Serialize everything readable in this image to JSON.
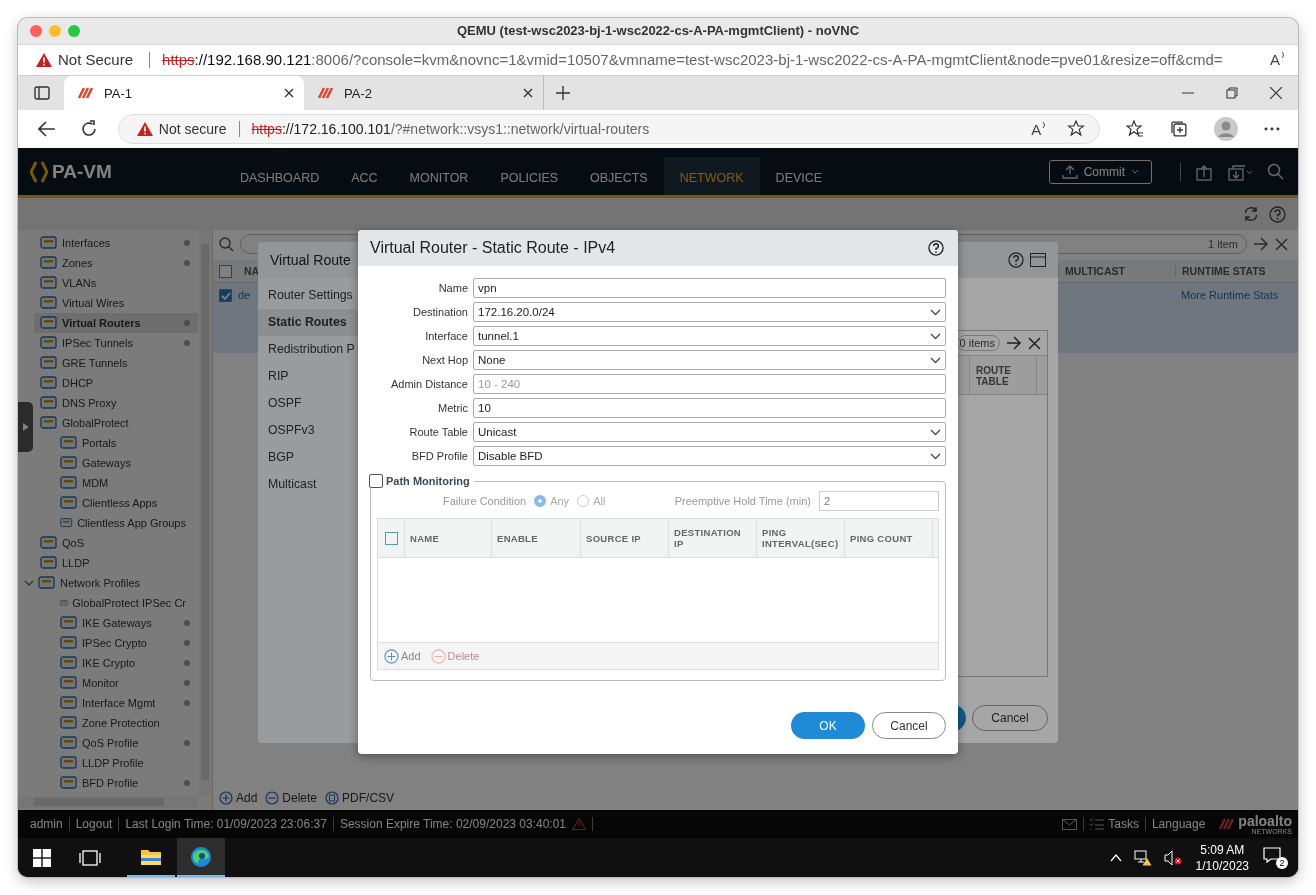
{
  "window": {
    "title": "QEMU (test-wsc2023-bj-1-wsc2022-cs-A-PA-mgmtClient) - noVNC"
  },
  "outer_address_bar": {
    "read_aloud": "A",
    "security": "Not Secure",
    "scheme": "https",
    "host": "://192.168.90.121",
    "rest": ":8006/?console=kvm&novnc=1&vmid=10507&vmname=test-wsc2023-bj-1-wsc2022-cs-A-PA-mgmtClient&node=pve01&resize=off&cmd="
  },
  "browser_tabs": [
    {
      "label": "PA-1",
      "selected": true
    },
    {
      "label": "PA-2",
      "selected": false
    }
  ],
  "address_bar": {
    "read_aloud": "A",
    "security": "Not secure",
    "scheme": "https",
    "host": "://172.16.100.101",
    "rest": "/?#network::vsys1::network/virtual-routers"
  },
  "app": {
    "logo": "PA-VM",
    "nav": [
      {
        "label": "DASHBOARD",
        "selected": false
      },
      {
        "label": "ACC",
        "selected": false
      },
      {
        "label": "MONITOR",
        "selected": false
      },
      {
        "label": "POLICIES",
        "selected": false
      },
      {
        "label": "OBJECTS",
        "selected": false
      },
      {
        "label": "NETWORK",
        "selected": true
      },
      {
        "label": "DEVICE",
        "selected": false
      }
    ],
    "commit": "Commit"
  },
  "sidebar": {
    "items": [
      {
        "label": "Interfaces",
        "dot": true,
        "selected": false
      },
      {
        "label": "Zones",
        "dot": true,
        "selected": false
      },
      {
        "label": "VLANs",
        "dot": false,
        "selected": false
      },
      {
        "label": "Virtual Wires",
        "dot": false,
        "selected": false
      },
      {
        "label": "Virtual Routers",
        "dot": true,
        "selected": true
      },
      {
        "label": "IPSec Tunnels",
        "dot": true,
        "selected": false
      },
      {
        "label": "GRE Tunnels",
        "dot": false,
        "selected": false
      },
      {
        "label": "DHCP",
        "dot": false,
        "selected": false
      },
      {
        "label": "DNS Proxy",
        "dot": false,
        "selected": false
      },
      {
        "label": "GlobalProtect",
        "dot": false,
        "selected": false,
        "children": [
          {
            "label": "Portals",
            "dot": false,
            "selected": false
          },
          {
            "label": "Gateways",
            "dot": false,
            "selected": false
          },
          {
            "label": "MDM",
            "dot": false,
            "selected": false
          },
          {
            "label": "Clientless Apps",
            "dot": false,
            "selected": false
          },
          {
            "label": "Clientless App Groups",
            "dot": false,
            "selected": false
          }
        ]
      },
      {
        "label": "QoS",
        "dot": false,
        "selected": false
      },
      {
        "label": "LLDP",
        "dot": false,
        "selected": false
      },
      {
        "label": "Network Profiles",
        "dot": false,
        "selected": false,
        "expanded": true,
        "children": [
          {
            "label": "GlobalProtect IPSec Cr",
            "dot": false,
            "selected": false
          },
          {
            "label": "IKE Gateways",
            "dot": true,
            "selected": false
          },
          {
            "label": "IPSec Crypto",
            "dot": true,
            "selected": false
          },
          {
            "label": "IKE Crypto",
            "dot": true,
            "selected": false
          },
          {
            "label": "Monitor",
            "dot": true,
            "selected": false
          },
          {
            "label": "Interface Mgmt",
            "dot": true,
            "selected": false
          },
          {
            "label": "Zone Protection",
            "dot": false,
            "selected": false
          },
          {
            "label": "QoS Profile",
            "dot": true,
            "selected": false
          },
          {
            "label": "LLDP Profile",
            "dot": false,
            "selected": false
          },
          {
            "label": "BFD Profile",
            "dot": true,
            "selected": false
          }
        ]
      }
    ]
  },
  "main_table": {
    "count": "1 item",
    "all_checked": false,
    "columns": [
      "NA",
      "MULTICAST",
      "RUNTIME STATS"
    ],
    "rows": [
      {
        "checked": true,
        "name": "de",
        "runtime_stats": "More Runtime Stats"
      }
    ],
    "actions": [
      "Add",
      "Delete",
      "PDF/CSV"
    ]
  },
  "router_dialog": {
    "title": "Virtual Route",
    "tabs": [
      {
        "label": "Router Settings",
        "selected": false
      },
      {
        "label": "Static Routes",
        "selected": true
      },
      {
        "label": "Redistribution P",
        "selected": false
      },
      {
        "label": "RIP",
        "selected": false
      },
      {
        "label": "OSPF",
        "selected": false
      },
      {
        "label": "OSPFv3",
        "selected": false
      },
      {
        "label": "BGP",
        "selected": false
      },
      {
        "label": "Multicast",
        "selected": false
      }
    ],
    "count": "0 items",
    "column": "ROUTE TABLE",
    "cancel": "Cancel"
  },
  "route_dialog": {
    "title": "Virtual Router - Static Route - IPv4",
    "fields": [
      {
        "label": "Name",
        "kind": "text",
        "value": "vpn"
      },
      {
        "label": "Destination",
        "kind": "select",
        "value": "172.16.20.0/24"
      },
      {
        "label": "Interface",
        "kind": "select",
        "value": "tunnel.1"
      },
      {
        "label": "Next Hop",
        "kind": "select",
        "value": "None"
      },
      {
        "label": "Admin Distance",
        "kind": "text",
        "placeholder": "10 - 240"
      },
      {
        "label": "Metric",
        "kind": "text",
        "value": "10"
      },
      {
        "label": "Route Table",
        "kind": "select",
        "value": "Unicast"
      },
      {
        "label": "BFD Profile",
        "kind": "select",
        "value": "Disable BFD"
      }
    ],
    "path_monitoring": {
      "label": "Path Monitoring",
      "checked": false,
      "all_checked": false,
      "failure_label": "Failure Condition",
      "options": [
        {
          "label": "Any",
          "selected": true
        },
        {
          "label": "All",
          "selected": false
        }
      ],
      "hold_label": "Preemptive Hold Time (min)",
      "hold_value": "2",
      "columns": [
        "NAME",
        "ENABLE",
        "SOURCE IP",
        "DESTINATION IP",
        "PING INTERVAL(SEC)",
        "PING COUNT"
      ],
      "add": "Add",
      "delete": "Delete"
    },
    "buttons": [
      "OK",
      "Cancel"
    ]
  },
  "status_bar": {
    "user": "admin",
    "logout": "Logout",
    "last_login": "Last Login Time: 01/09/2023 23:06:37",
    "session": "Session Expire Time: 02/09/2023 03:40:01",
    "tasks": "Tasks",
    "language": "Language",
    "brand": "paloalto",
    "brand_sub": "NETWORKS"
  },
  "taskbar": {
    "time": "5:09 AM",
    "date": "1/10/2023",
    "notifications": "2"
  }
}
